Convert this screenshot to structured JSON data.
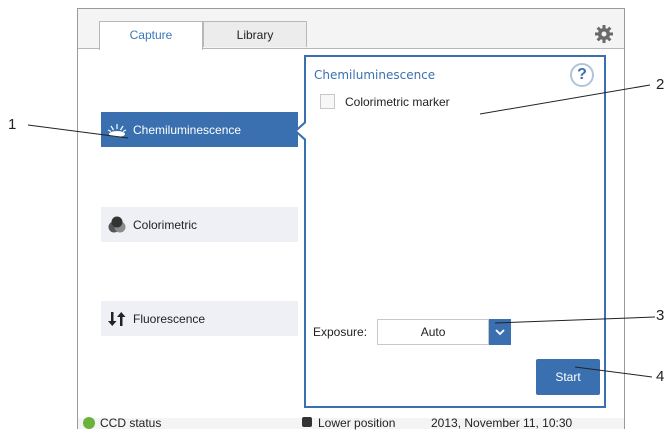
{
  "tabs": [
    {
      "label": "Capture",
      "active": true
    },
    {
      "label": "Library",
      "active": false
    }
  ],
  "modes": [
    {
      "label": "Chemiluminescence",
      "icon": "chemiluminescence-icon",
      "selected": true
    },
    {
      "label": "Colorimetric",
      "icon": "colorimetric-icon",
      "selected": false
    },
    {
      "label": "Fluorescence",
      "icon": "fluorescence-icon",
      "selected": false
    }
  ],
  "panel": {
    "title": "Chemiluminescence",
    "help_label": "?",
    "colorimetric_marker_label": "Colorimetric marker",
    "exposure_label": "Exposure:",
    "exposure_value": "Auto",
    "start_label": "Start"
  },
  "status": {
    "ccd_label": "CCD status",
    "position_label": "Lower position",
    "datetime": "2013, November 11, 10:30"
  },
  "callouts": [
    "1",
    "2",
    "3",
    "4"
  ],
  "colors": {
    "accent": "#3a70b0",
    "status_ok": "#6ab23a"
  }
}
